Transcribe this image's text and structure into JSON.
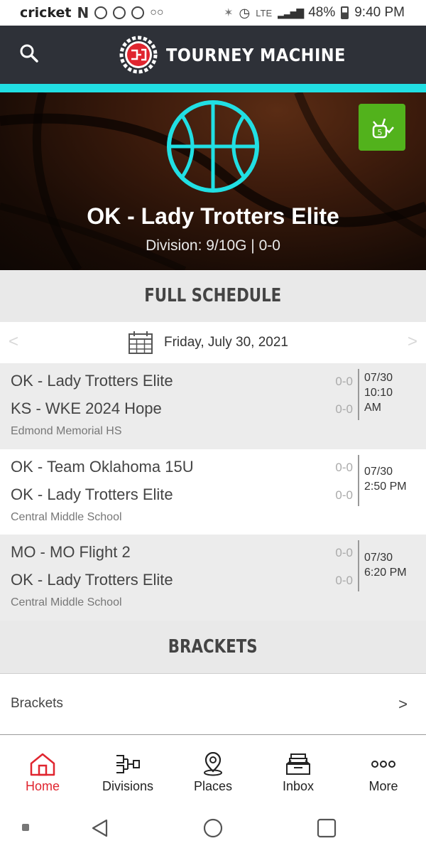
{
  "status_bar": {
    "carrier": "cricket",
    "network": "LTE",
    "battery": "48%",
    "time": "9:40 PM"
  },
  "header": {
    "app_name": "TOURNEY MACHINE",
    "search_icon": "search-icon",
    "colors": {
      "bar": "#2e3138",
      "accent": "#21dfe3"
    }
  },
  "hero": {
    "team_name": "OK - Lady Trotters Elite",
    "subtitle": "Division: 9/10G | 0-0",
    "badge_icon": "follow-check-icon",
    "badge_color": "#52b21c"
  },
  "schedule": {
    "header": "FULL SCHEDULE",
    "date": "Friday, July 30, 2021",
    "prev": "<",
    "next": ">",
    "games": [
      {
        "team1": "OK - Lady Trotters Elite",
        "score1": "0-0",
        "team2": "KS - WKE 2024 Hope",
        "score2": "0-0",
        "venue": "Edmond Memorial HS",
        "date": "07/30",
        "time_line1": "10:10",
        "time_line2": "AM"
      },
      {
        "team1": "OK - Team Oklahoma 15U",
        "score1": "0-0",
        "team2": "OK - Lady Trotters Elite",
        "score2": "0-0",
        "venue": "Central Middle School",
        "date": "07/30",
        "time": "2:50 PM"
      },
      {
        "team1": "MO - MO Flight 2",
        "score1": "0-0",
        "team2": "OK - Lady Trotters Elite",
        "score2": "0-0",
        "venue": "Central Middle School",
        "date": "07/30",
        "time": "6:20 PM"
      }
    ]
  },
  "brackets": {
    "header": "BRACKETS",
    "row_label": "Brackets",
    "chevron": ">"
  },
  "bottom_nav": {
    "active_color": "#e0252f",
    "items": [
      {
        "label": "Home",
        "icon": "home-icon"
      },
      {
        "label": "Divisions",
        "icon": "bracket-icon"
      },
      {
        "label": "Places",
        "icon": "map-pin-icon"
      },
      {
        "label": "Inbox",
        "icon": "inbox-icon"
      },
      {
        "label": "More",
        "icon": "more-icon"
      }
    ]
  }
}
